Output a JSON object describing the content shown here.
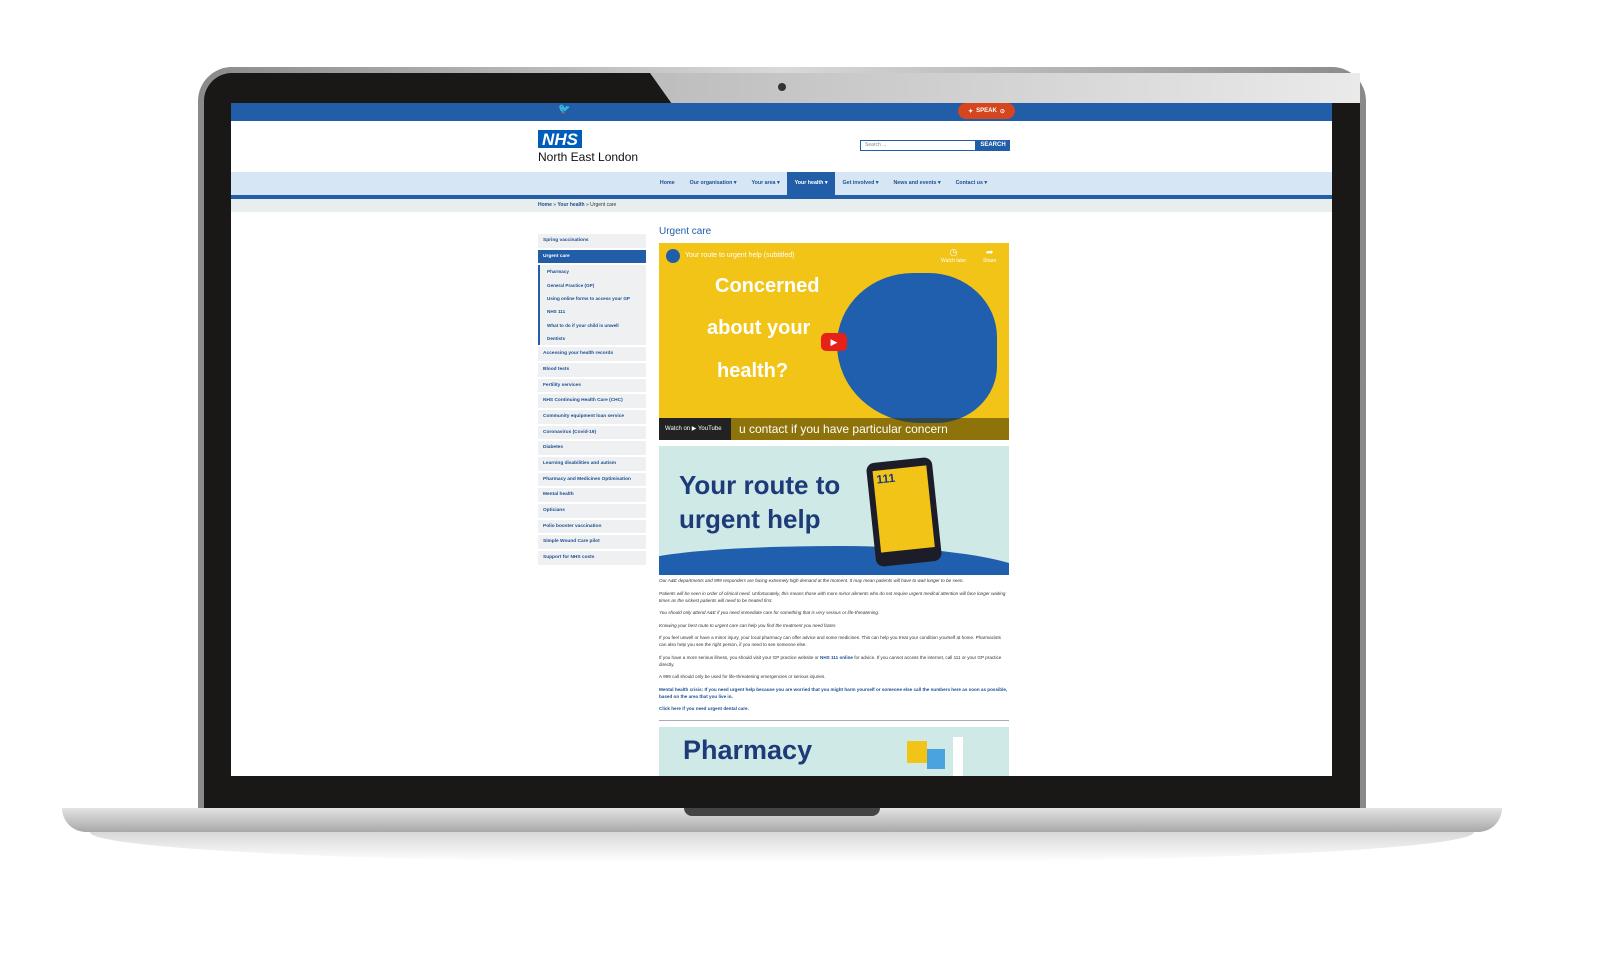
{
  "topbar": {
    "social_icon": "twitter-icon",
    "speak_label": "SPEAK"
  },
  "header": {
    "logo": "NHS",
    "org_name": "North East London",
    "search_placeholder": "Search ...",
    "search_button": "SEARCH"
  },
  "nav": {
    "items": [
      {
        "label": "Home"
      },
      {
        "label": "Our organisation ▾"
      },
      {
        "label": "Your area ▾"
      },
      {
        "label": "Your health ▾",
        "active": true
      },
      {
        "label": "Get involved ▾"
      },
      {
        "label": "News and events ▾"
      },
      {
        "label": "Contact us ▾"
      }
    ]
  },
  "breadcrumb": {
    "home": "Home",
    "sep": " » ",
    "section": "Your health",
    "current": "Urgent care"
  },
  "sidebar": {
    "top": [
      "Spring vaccinations"
    ],
    "active": "Urgent care",
    "subitems": [
      "Pharmacy",
      "General Practice (GP)",
      "Using online forms to access your GP",
      "NHS 111",
      "What to do if your child is unwell",
      "Dentists"
    ],
    "items": [
      "Accessing your health records",
      "Blood tests",
      "Fertility services",
      "NHS Continuing Health Care (CHC)",
      "Community equipment loan service",
      "Coronavirus (Covid-19)",
      "Diabetes",
      "Learning disabilities and autism",
      "Pharmacy and Medicines Optimisation",
      "Mental health",
      "Opticians",
      "Polio booster vaccination",
      "Simple Wound Care pilot",
      "Support for NHS costs"
    ]
  },
  "main": {
    "title": "Urgent care",
    "video": {
      "title": "Your route to urgent help (subtitled)",
      "watch_later": "Watch later",
      "share": "Share",
      "line1": "Concerned",
      "line2": "about your",
      "line3": "health?",
      "caption": "u contact if you have particular concern",
      "watch_on": "Watch on ▶ YouTube"
    },
    "banner": {
      "line1": "Your route to",
      "line2": "urgent help",
      "phone_text": "111"
    },
    "paragraphs": [
      "Our A&E departments and 999 responders are facing extremely high demand at the moment. It may mean patients will have to wait longer to be seen.",
      "Patients will be seen in order of clinical need. Unfortunately, this means those with more minor ailments who do not require urgent medical attention will face longer waiting times as the sickest patients will need to be treated first.",
      "You should only attend A&E if you need immediate care for something that is very serious or life-threatening.",
      "Knowing your best route to urgent care can help you find the treatment you need faster."
    ],
    "p5": "If you feel unwell or have a minor injury, your local pharmacy can offer advice and some medicines. This can help you treat your condition yourself at home. Pharmacists can also help you see the right person, if you need to see someone else.",
    "p6a": "If you have a more serious illness, you should visit your GP practice website or ",
    "p6link": "NHS 111 online",
    "p6b": " for advice. If you cannot access the internet, call 111 or your GP practice directly.",
    "p7": "A 999 call should only be used for life-threatening emergencies or serious injuries.",
    "mental_health": "Mental health crisis: If you need urgent help because you are worried that you might harm yourself or someone else call the numbers here as soon as possible, based on the area that you live in.",
    "dental": "Click here if you need urgent dental care.",
    "pharmacy_banner": "Pharmacy"
  },
  "colors": {
    "nhs_blue": "#225ea8",
    "nav_bg": "#d6e6f5",
    "speak": "#d5451e",
    "video_yellow": "#f2c418",
    "banner_teal": "#cfe9e6"
  }
}
